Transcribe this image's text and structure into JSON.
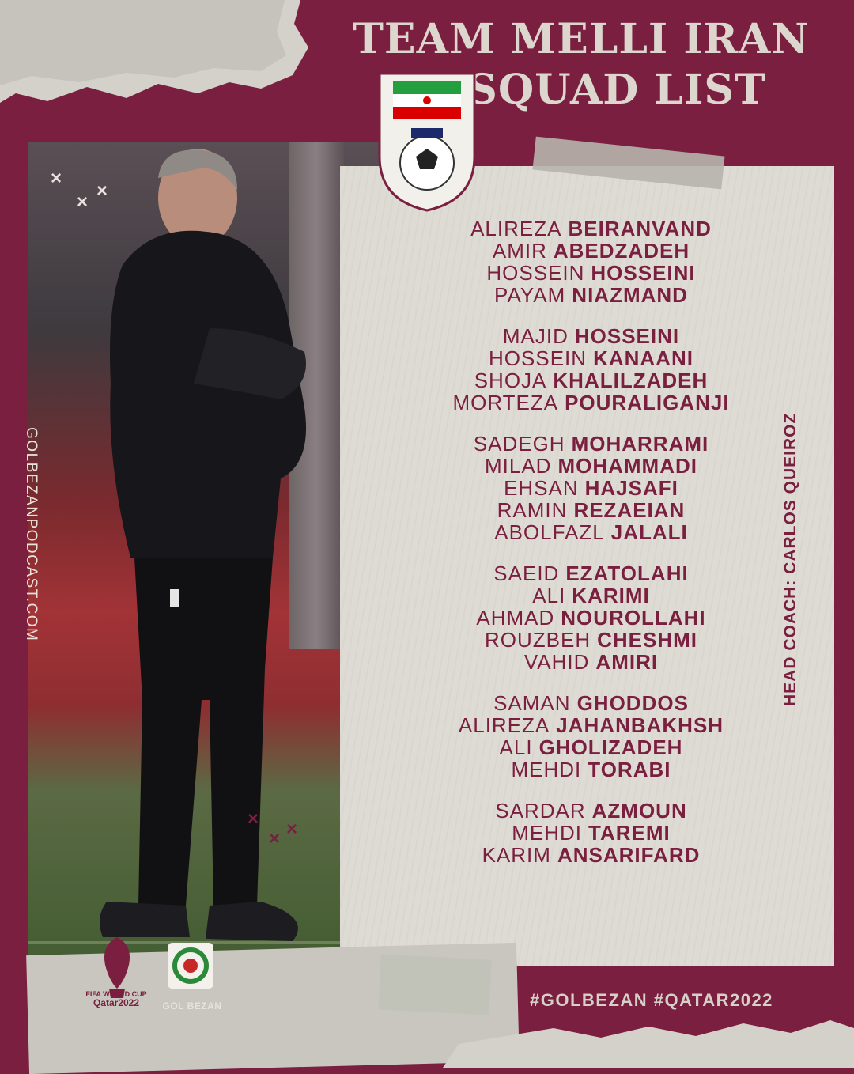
{
  "title": {
    "line1": "TEAM MELLI IRAN",
    "line2": "SQUAD LIST"
  },
  "website": "GOLBEZANPODCAST.COM",
  "head_coach": "HEAD COACH: CARLOS QUEIROZ",
  "hashtags": "#GOLBEZAN #QATAR2022",
  "logos": {
    "worldcup_line1": "FIFA WORLD CUP",
    "worldcup_line2": "Qatar2022",
    "golbezan": "GOL BEZAN",
    "crest_icon": "iran-football-federation-crest"
  },
  "groups": [
    [
      {
        "first": "ALIREZA",
        "last": "BEIRANVAND"
      },
      {
        "first": "AMIR",
        "last": "ABEDZADEH"
      },
      {
        "first": "HOSSEIN",
        "last": "HOSSEINI"
      },
      {
        "first": "PAYAM",
        "last": "NIAZMAND"
      }
    ],
    [
      {
        "first": "MAJID",
        "last": "HOSSEINI"
      },
      {
        "first": "HOSSEIN",
        "last": "KANAANI"
      },
      {
        "first": "SHOJA",
        "last": "KHALILZADEH"
      },
      {
        "first": "MORTEZA",
        "last": "POURALIGANJI"
      }
    ],
    [
      {
        "first": "SADEGH",
        "last": "MOHARRAMI"
      },
      {
        "first": "MILAD",
        "last": "MOHAMMADI"
      },
      {
        "first": "EHSAN",
        "last": "HAJSAFI"
      },
      {
        "first": "RAMIN",
        "last": "REZAEIAN"
      },
      {
        "first": "ABOLFAZL",
        "last": "JALALI"
      }
    ],
    [
      {
        "first": "SAEID",
        "last": "EZATOLAHI"
      },
      {
        "first": "ALI",
        "last": "KARIMI"
      },
      {
        "first": "AHMAD",
        "last": "NOUROLLAHI"
      },
      {
        "first": "ROUZBEH",
        "last": "CHESHMI"
      },
      {
        "first": "VAHID",
        "last": "AMIRI"
      }
    ],
    [
      {
        "first": "SAMAN",
        "last": "GHODDOS"
      },
      {
        "first": "ALIREZA",
        "last": "JAHANBAKHSH"
      },
      {
        "first": "ALI",
        "last": "GHOLIZADEH"
      },
      {
        "first": "MEHDI",
        "last": "TORABI"
      }
    ],
    [
      {
        "first": "SARDAR",
        "last": "AZMOUN"
      },
      {
        "first": "MEHDI",
        "last": "TAREMI"
      },
      {
        "first": "KARIM",
        "last": "ANSARIFARD"
      }
    ]
  ],
  "colors": {
    "maroon": "#7a1f3f",
    "paper": "#dedbd4",
    "cream": "#dcd6cf"
  }
}
